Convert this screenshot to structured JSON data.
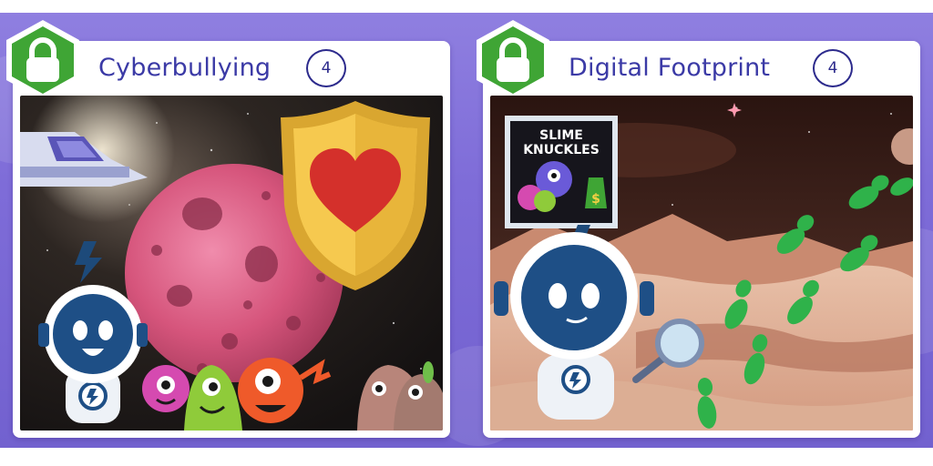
{
  "cards": [
    {
      "title": "Cyberbullying",
      "count": "4",
      "locked": true,
      "badge_color": "#3fa535",
      "icons": [
        "lock-icon",
        "shield-heart-icon",
        "astronaut",
        "monster",
        "planet",
        "spaceship"
      ]
    },
    {
      "title": "Digital Footprint",
      "count": "4",
      "locked": true,
      "badge_color": "#3fa535",
      "poster_line_1": "SLIME",
      "poster_line_2": "KNUCKLES",
      "icons": [
        "lock-icon",
        "magnifying-glass-icon",
        "footprint-icon",
        "astronaut",
        "poster"
      ]
    }
  ],
  "colors": {
    "background": "#7e6cd8",
    "card": "#ffffff",
    "title_text": "#3b3aa6",
    "lock_green": "#3fa535"
  }
}
